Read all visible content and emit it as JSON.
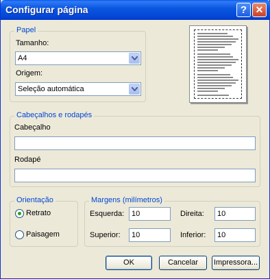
{
  "window": {
    "title": "Configurar página"
  },
  "paper": {
    "legend": "Papel",
    "size_label": "Tamanho:",
    "size_value": "A4",
    "source_label": "Origem:",
    "source_value": "Seleção automática"
  },
  "headers": {
    "legend": "Cabeçalhos e rodapés",
    "header_label": "Cabeçalho",
    "header_value": "",
    "footer_label": "Rodapé",
    "footer_value": ""
  },
  "orientation": {
    "legend": "Orientação",
    "portrait": "Retrato",
    "landscape": "Paisagem",
    "selected": "portrait"
  },
  "margins": {
    "legend": "Margens (milímetros)",
    "left_label": "Esquerda:",
    "left_value": "10",
    "right_label": "Direita:",
    "right_value": "10",
    "top_label": "Superior:",
    "top_value": "10",
    "bottom_label": "Inferior:",
    "bottom_value": "10"
  },
  "buttons": {
    "ok": "OK",
    "cancel": "Cancelar",
    "printer": "Impressora..."
  },
  "icons": {
    "help": "help-icon",
    "close": "close-icon",
    "dropdown": "chevron-down-icon"
  }
}
